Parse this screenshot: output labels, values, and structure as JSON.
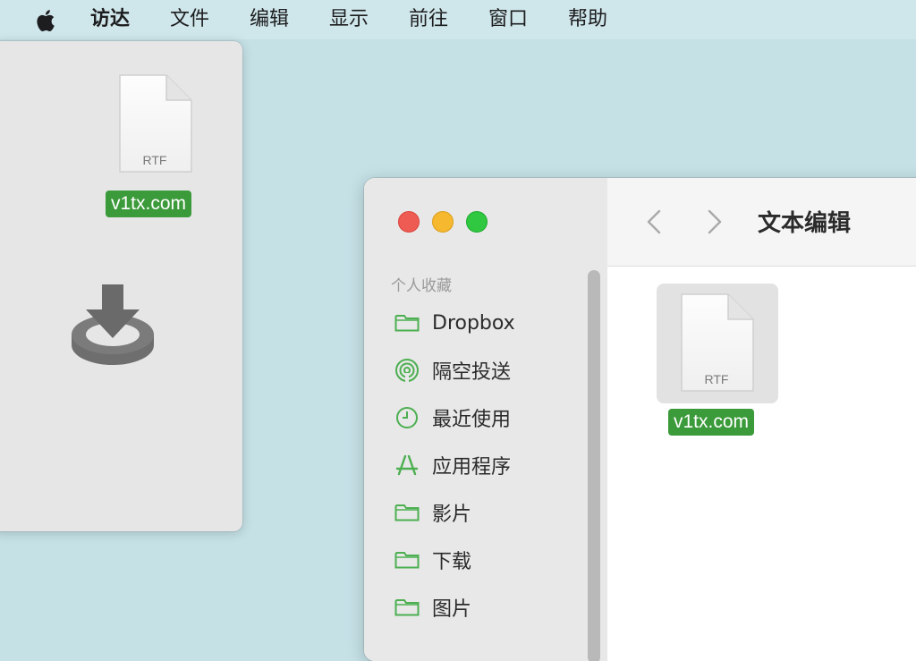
{
  "menubar": {
    "items": [
      "访达",
      "文件",
      "编辑",
      "显示",
      "前往",
      "窗口",
      "帮助"
    ]
  },
  "dmg": {
    "file_type": "RTF",
    "file_name": "v1tx.com",
    "install_icon": "disk-install-icon"
  },
  "finder": {
    "title": "文本编辑",
    "sidebar_section": "个人收藏",
    "sidebar_items": [
      {
        "label": "Dropbox",
        "icon": "folder-icon"
      },
      {
        "label": "隔空投送",
        "icon": "airdrop-icon"
      },
      {
        "label": "最近使用",
        "icon": "clock-icon"
      },
      {
        "label": "应用程序",
        "icon": "apps-icon"
      },
      {
        "label": "影片",
        "icon": "folder-icon"
      },
      {
        "label": "下载",
        "icon": "folder-icon"
      },
      {
        "label": "图片",
        "icon": "folder-icon"
      }
    ],
    "file": {
      "type": "RTF",
      "name": "v1tx.com"
    }
  },
  "colors": {
    "accent_green": "#3b9a3a",
    "sidebar_icon_green": "#4caf50",
    "desktop": "#c5e1e6"
  }
}
